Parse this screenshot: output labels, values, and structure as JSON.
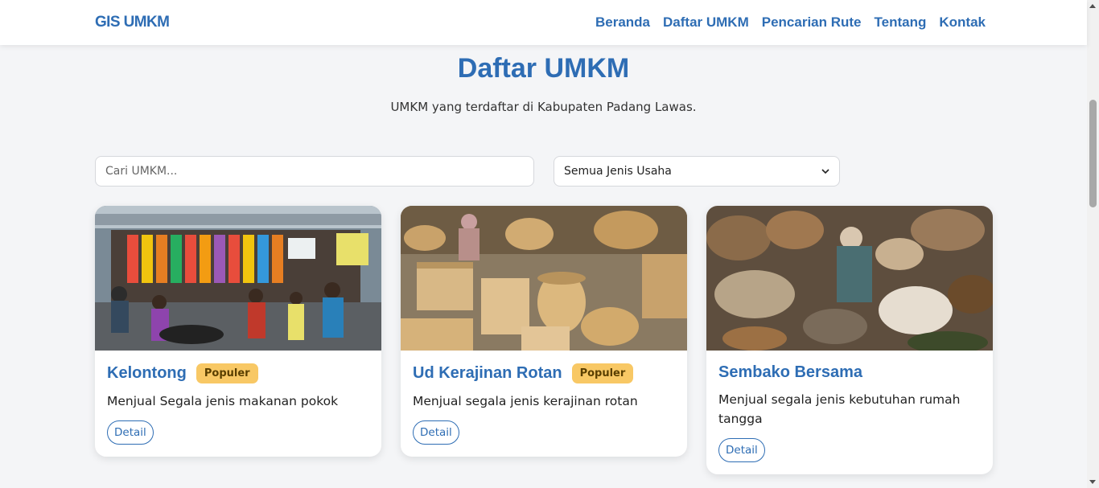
{
  "nav": {
    "brand": "GIS UMKM",
    "links": [
      "Beranda",
      "Daftar UMKM",
      "Pencarian Rute",
      "Tentang",
      "Kontak"
    ]
  },
  "header": {
    "title": "Daftar UMKM",
    "subtitle": "UMKM yang terdaftar di Kabupaten Padang Lawas."
  },
  "filters": {
    "search_placeholder": "Cari UMKM...",
    "category_selected": "Semua Jenis Usaha"
  },
  "cards": [
    {
      "title": "Kelontong",
      "badge": "Populer",
      "description": "Menjual Segala jenis makanan pokok",
      "button": "Detail"
    },
    {
      "title": "Ud Kerajinan Rotan",
      "badge": "Populer",
      "description": "Menjual segala jenis kerajinan rotan",
      "button": "Detail"
    },
    {
      "title": "Sembako Bersama",
      "badge": "",
      "description": "Menjual segala jenis kebutuhan rumah tangga",
      "button": "Detail"
    }
  ],
  "colors": {
    "accent": "#2e6db4",
    "badge": "#f8c865"
  },
  "icons": {
    "select": "chevron-down-icon"
  }
}
